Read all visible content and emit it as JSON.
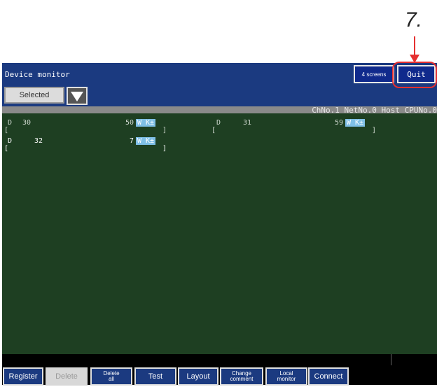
{
  "callout_label": "7.",
  "titlebar": {
    "title": "Device monitor",
    "screens_btn": "4 screens",
    "quit_btn": "Quit"
  },
  "selector": {
    "value": "Selected"
  },
  "status": "ChNo.1 NetNo.0 Host CPUNo.0",
  "entries": [
    {
      "device": "D",
      "number": "30",
      "value": "50",
      "format": "W K±",
      "open": "[",
      "close": "]"
    },
    {
      "device": "D",
      "number": "31",
      "value": "59",
      "format": "W K±",
      "open": "[",
      "close": "]"
    },
    {
      "device": "D",
      "number": "32",
      "value": "7",
      "format": "W K±",
      "open": "[",
      "close": "]"
    }
  ],
  "function_keys": [
    {
      "label": "Register",
      "enabled": true
    },
    {
      "label": "Delete",
      "enabled": false
    },
    {
      "label": "Delete\nall",
      "enabled": true
    },
    {
      "label": "Test",
      "enabled": true
    },
    {
      "label": "Layout",
      "enabled": true
    },
    {
      "label": "Change\ncomment",
      "enabled": true
    },
    {
      "label": "Local\nmonitor",
      "enabled": true
    },
    {
      "label": "Connect",
      "enabled": true
    }
  ],
  "colors": {
    "accent_callout": "#e53030",
    "screen_bg": "#1e3f22",
    "bar_bg": "#1b3a80"
  }
}
